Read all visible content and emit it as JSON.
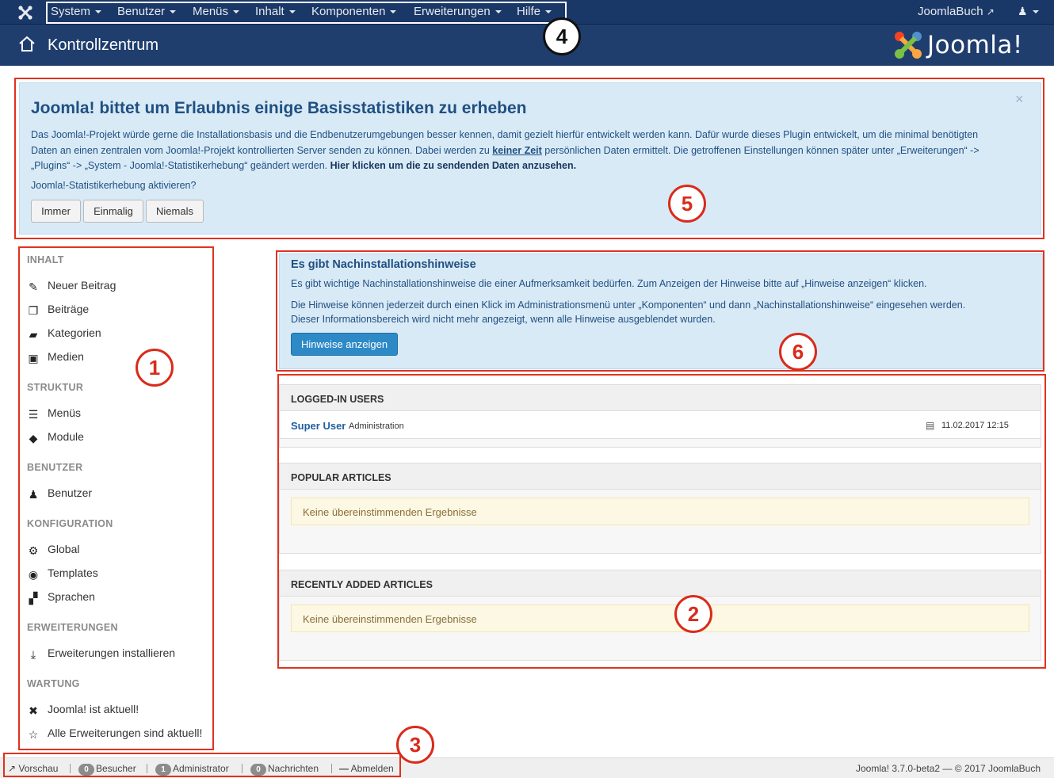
{
  "topbar": {
    "menu": [
      "System",
      "Benutzer",
      "Menüs",
      "Inhalt",
      "Komponenten",
      "Erweiterungen",
      "Hilfe"
    ],
    "site_link": "JoomlaBuch",
    "icons": {
      "logo": "joomla-logo-icon",
      "user": "user-icon",
      "external": "external-link-icon"
    }
  },
  "header": {
    "title": "Kontrollzentrum",
    "logo_text": "Joomla!"
  },
  "annotations": [
    "1",
    "2",
    "3",
    "4",
    "5",
    "6"
  ],
  "stats": {
    "title": "Joomla! bittet um Erlaubnis einige Basisstatistiken zu erheben",
    "text_a": "Das Joomla!-Projekt würde gerne die Installationsbasis und die Endbenutzerumgebungen besser kennen, damit gezielt hierfür entwickelt werden kann. Dafür wurde dieses Plugin entwickelt, um die minimal benötigten Daten an einen zentralen vom Joomla!-Projekt kontrollierten Server senden zu können. Dabei werden zu ",
    "text_link": "keiner Zeit",
    "text_b": " persönlichen Daten ermittelt. Die getroffenen Einstellungen können später unter „Erweiterungen“ -> „Plugins“ -> „System - Joomla!-Statistikerhebung“ geändert werden. ",
    "text_bold": "Hier klicken um die zu sendenden Daten anzusehen.",
    "question": "Joomla!-Statistikerhebung aktivieren?",
    "buttons": [
      "Immer",
      "Einmalig",
      "Niemals"
    ],
    "close": "×"
  },
  "sidebar": {
    "sections": [
      "INHALT",
      "STRUKTUR",
      "BENUTZER",
      "KONFIGURATION",
      "ERWEITERUNGEN",
      "WARTUNG"
    ],
    "items": [
      {
        "label": "Neuer Beitrag",
        "icon": "pencil-icon"
      },
      {
        "label": "Beiträge",
        "icon": "copy-icon"
      },
      {
        "label": "Kategorien",
        "icon": "folder-icon"
      },
      {
        "label": "Medien",
        "icon": "image-icon"
      },
      {
        "label": "Menüs",
        "icon": "list-icon"
      },
      {
        "label": "Module",
        "icon": "cube-icon"
      },
      {
        "label": "Benutzer",
        "icon": "users-icon"
      },
      {
        "label": "Global",
        "icon": "gear-icon"
      },
      {
        "label": "Templates",
        "icon": "eye-icon"
      },
      {
        "label": "Sprachen",
        "icon": "comments-icon"
      },
      {
        "label": "Erweiterungen installieren",
        "icon": "download-icon"
      },
      {
        "label": "Joomla! ist aktuell!",
        "icon": "joomla-icon"
      },
      {
        "label": "Alle Erweiterungen sind aktuell!",
        "icon": "star-icon"
      }
    ]
  },
  "postinstall": {
    "title": "Es gibt Nachinstallationshinweise",
    "line1": "Es gibt wichtige Nachinstallationshinweise die einer Aufmerksamkeit bedürfen. Zum Anzeigen der Hinweise bitte auf „Hinweise anzeigen“ klicken.",
    "line2": "Die Hinweise können jederzeit durch einen Klick im Administrationsmenü unter „Komponenten“ und dann „Nachinstallationshinweise“ eingesehen werden.",
    "line3": "Dieser Informationsbereich wird nicht mehr angezeigt, wenn alle Hinweise ausgeblendet wurden.",
    "button": "Hinweise anzeigen"
  },
  "modules": {
    "logged_in": {
      "title": "LOGGED-IN USERS",
      "user": "Super User",
      "area": "Administration",
      "date": "11.02.2017 12:15"
    },
    "popular": {
      "title": "POPULAR ARTICLES",
      "empty": "Keine übereinstimmenden Ergebnisse"
    },
    "recent": {
      "title": "RECENTLY ADDED ARTICLES",
      "empty": "Keine übereinstimmenden Ergebnisse"
    }
  },
  "footer": {
    "preview": "Vorschau",
    "visitors_count": "0",
    "visitors": "Besucher",
    "admins_count": "1",
    "admins": "Administrator",
    "messages_count": "0",
    "messages": "Nachrichten",
    "logout": "Abmelden",
    "version": "Joomla! 3.7.0-beta2",
    "dash": "—",
    "copyright": "© 2017 JoomlaBuch"
  },
  "colors": {
    "navbar": "#1a3867",
    "header": "#1f3e6e",
    "alert_bg": "#d9eaf7",
    "primary": "#2d8ac7",
    "annotation": "#d92b1b"
  }
}
